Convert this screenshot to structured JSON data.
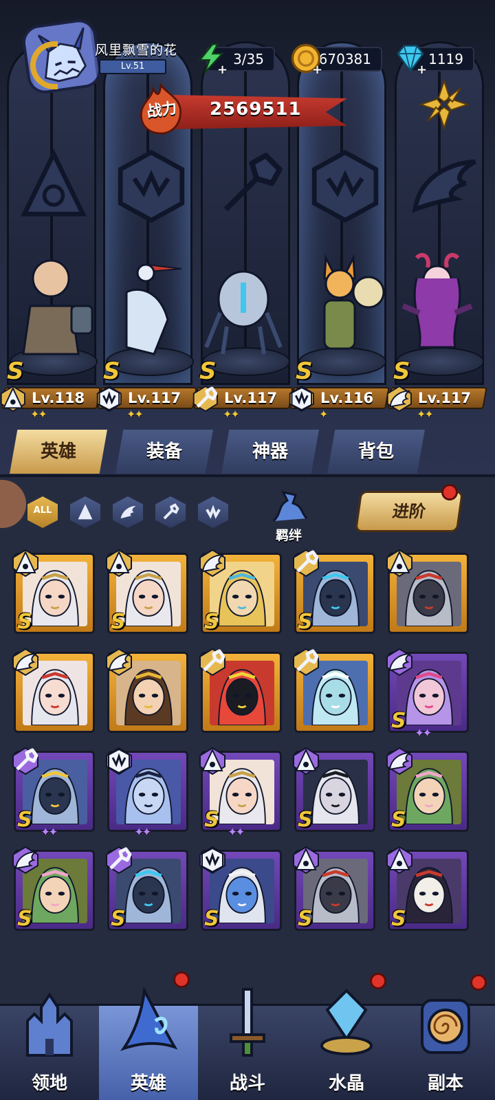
{
  "player": {
    "name": "风里飘雪的花",
    "level": "Lv.51"
  },
  "resources": [
    {
      "icon": "energy-icon",
      "value": "3/35"
    },
    {
      "icon": "coin-icon",
      "value": "670381"
    },
    {
      "icon": "diamond-icon",
      "value": "1119"
    }
  ],
  "power": {
    "label": "战力",
    "value": "2569511"
  },
  "team": [
    {
      "name": "bald-warrior",
      "rank": "S",
      "level": "Lv.118",
      "class": "mage",
      "stars": 2
    },
    {
      "name": "heron-sage",
      "rank": "S",
      "level": "Lv.117",
      "class": "beast",
      "stars": 2
    },
    {
      "name": "mech-spider",
      "rank": "S",
      "level": "Lv.117",
      "class": "mech",
      "stars": 2
    },
    {
      "name": "cat-drummer",
      "rank": "S",
      "level": "Lv.116",
      "class": "beast",
      "stars": 1
    },
    {
      "name": "succubus",
      "rank": "S",
      "level": "Lv.117",
      "class": "wing",
      "stars": 2
    }
  ],
  "tabs": [
    "英雄",
    "装备",
    "神器",
    "背包"
  ],
  "filters": {
    "all": "ALL",
    "bond": "羁绊",
    "advance": "进阶"
  },
  "grid": [
    {
      "tier": "gold",
      "class": "mage",
      "portrait": "horned-priestess",
      "rank": "S"
    },
    {
      "tier": "gold",
      "class": "mage",
      "portrait": "horned-priestess",
      "rank": "S"
    },
    {
      "tier": "gold",
      "class": "wing",
      "portrait": "golden-knight",
      "rank": "S"
    },
    {
      "tier": "gold",
      "class": "mech",
      "portrait": "mech-helmet",
      "rank": "S"
    },
    {
      "tier": "gold",
      "class": "mage",
      "portrait": "iron-helm",
      "rank": ""
    },
    {
      "tier": "gold",
      "class": "wing",
      "portrait": "pale-elf",
      "rank": ""
    },
    {
      "tier": "gold",
      "class": "wing",
      "portrait": "brunette-queen",
      "rank": ""
    },
    {
      "tier": "gold",
      "class": "mech",
      "portrait": "red-robot",
      "rank": ""
    },
    {
      "tier": "gold",
      "class": "mech",
      "portrait": "ghost-spirit",
      "rank": ""
    },
    {
      "tier": "purple",
      "class": "wing",
      "portrait": "purple-succubus",
      "rank": "S"
    },
    {
      "tier": "purple",
      "class": "mech",
      "portrait": "mech-claw",
      "rank": "S"
    },
    {
      "tier": "purple",
      "class": "beast",
      "portrait": "dragon-skull",
      "rank": ""
    },
    {
      "tier": "purple",
      "class": "mage",
      "portrait": "horned-priestess",
      "rank": "S"
    },
    {
      "tier": "purple",
      "class": "mage",
      "portrait": "dark-vampire",
      "rank": "S"
    },
    {
      "tier": "purple",
      "class": "wing",
      "portrait": "green-dryad",
      "rank": "S"
    },
    {
      "tier": "purple",
      "class": "wing",
      "portrait": "green-dryad",
      "rank": "S"
    },
    {
      "tier": "purple",
      "class": "mech",
      "portrait": "mech-helmet",
      "rank": "S"
    },
    {
      "tier": "purple",
      "class": "beast",
      "portrait": "blue-ogre",
      "rank": "S"
    },
    {
      "tier": "purple",
      "class": "mage",
      "portrait": "iron-helm",
      "rank": "S"
    },
    {
      "tier": "purple",
      "class": "mage",
      "portrait": "bandaged-nun",
      "rank": "S"
    }
  ],
  "nav": [
    {
      "label": "领地",
      "icon": "castle-icon"
    },
    {
      "label": "英雄",
      "icon": "wizard-hat-icon"
    },
    {
      "label": "战斗",
      "icon": "sword-icon"
    },
    {
      "label": "水晶",
      "icon": "crystal-icon"
    },
    {
      "label": "副本",
      "icon": "portal-icon"
    }
  ],
  "colors": {
    "gold": "#f0c63b",
    "purple": "#7348b8",
    "red": "#c63a2e",
    "panel": "#262c40"
  }
}
